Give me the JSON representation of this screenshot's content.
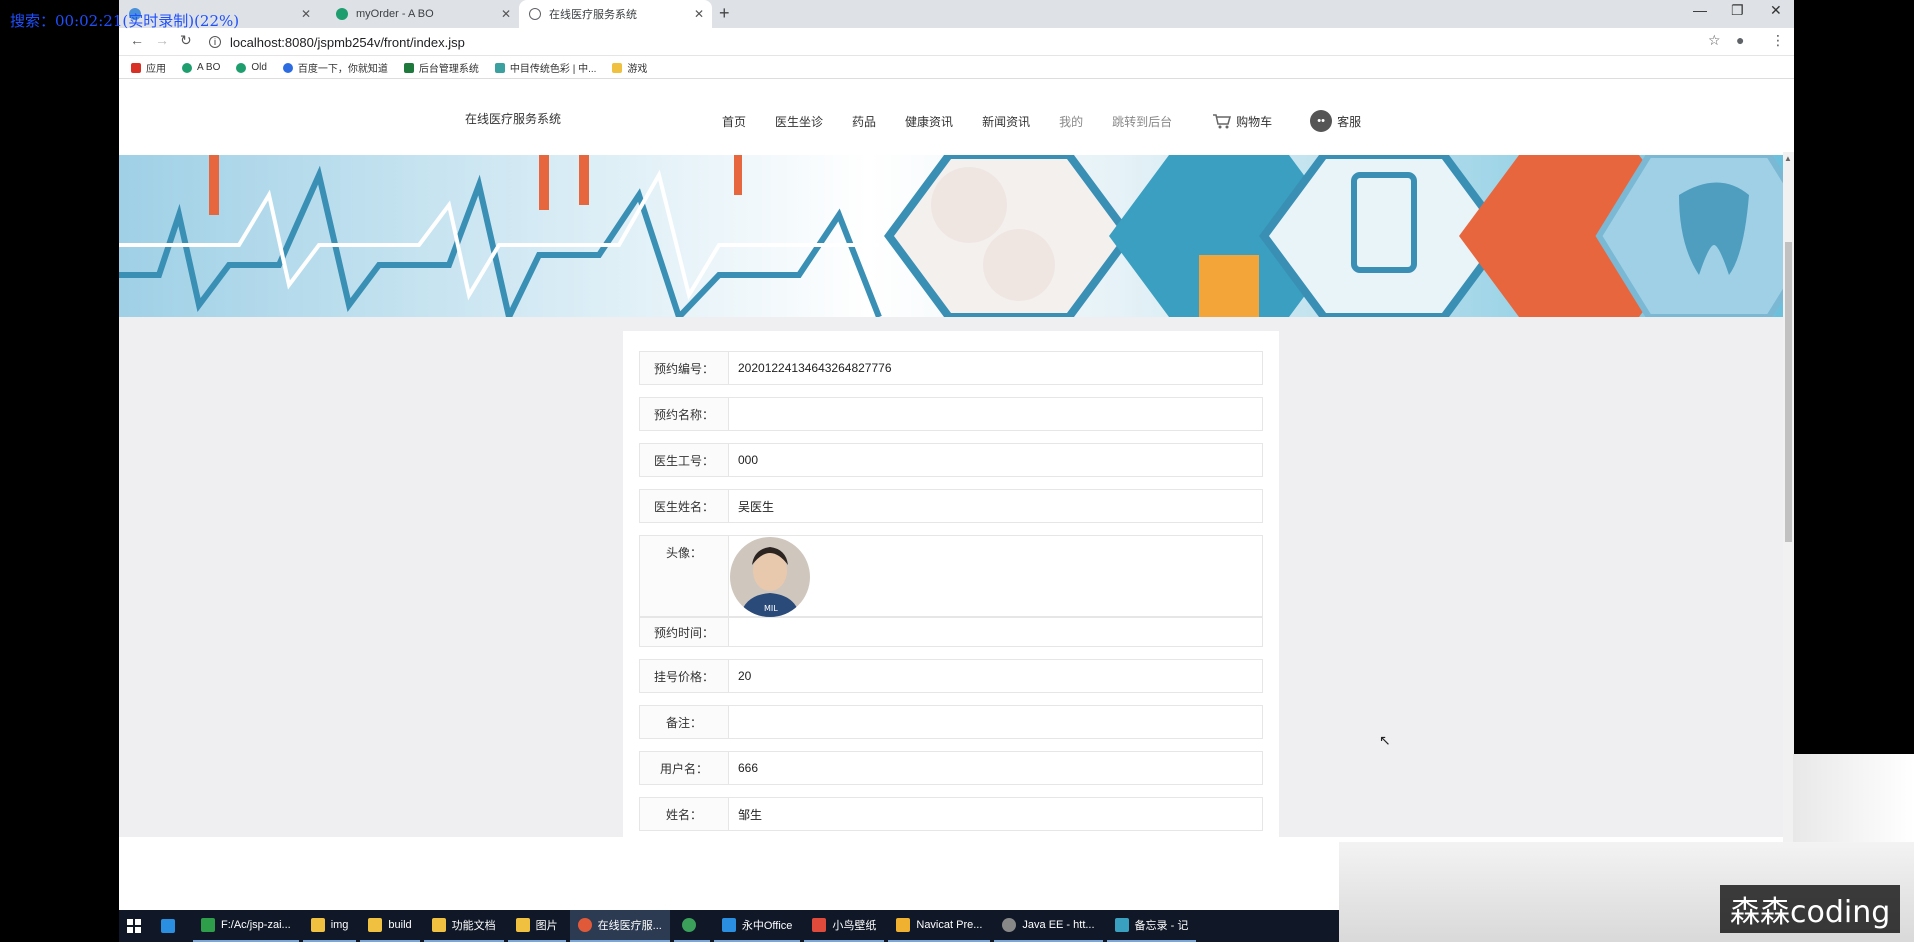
{
  "overlay": {
    "timer": "搜索：00:02:21(实时录制)(22%)"
  },
  "browser": {
    "tabs": [
      {
        "label": "",
        "fav_color": "#4a90d9"
      },
      {
        "label": "myOrder - A BO",
        "fav_color": "#1e9e6e"
      },
      {
        "label": "在线医疗服务系统",
        "fav_color": "#5f6368"
      }
    ],
    "new_tab": "+",
    "close_glyph": "✕",
    "window_controls": {
      "minimize": "—",
      "maximize": "❐",
      "close": "✕"
    },
    "nav": {
      "back": "←",
      "forward": "→",
      "reload": "↻"
    },
    "url": "localhost:8080/jspmb254v/front/index.jsp",
    "star": "☆",
    "profile": "●",
    "menu": "⋮",
    "bookmarks": [
      {
        "label": "应用",
        "color": "#d93025"
      },
      {
        "label": "A BO",
        "color": "#1e9e6e"
      },
      {
        "label": "Old",
        "color": "#1e9e6e"
      },
      {
        "label": "百度一下，你就知道",
        "color": "#2d6ce0"
      },
      {
        "label": "后台管理系统",
        "color": "#1e7a3c"
      },
      {
        "label": "中目传统色彩 | 中...",
        "color": "#3aa0a0"
      },
      {
        "label": "游戏",
        "color": "#f0c040"
      }
    ]
  },
  "site": {
    "brand": "在线医疗服务系统",
    "nav": [
      "首页",
      "医生坐诊",
      "药品",
      "健康资讯",
      "新闻资讯",
      "我的",
      "跳转到后台"
    ],
    "cart": "购物车",
    "service": "客服"
  },
  "detail": {
    "rows": [
      {
        "label": "预约编号：",
        "value": "20201224134643264827776"
      },
      {
        "label": "预约名称：",
        "value": ""
      },
      {
        "label": "医生工号：",
        "value": "000"
      },
      {
        "label": "医生姓名：",
        "value": "吴医生"
      }
    ],
    "avatar_label": "头像：",
    "rows2": [
      {
        "label": "预约时间：",
        "value": ""
      },
      {
        "label": "挂号价格：",
        "value": "20"
      },
      {
        "label": "备注：",
        "value": ""
      },
      {
        "label": "用户名：",
        "value": "666"
      },
      {
        "label": "姓名：",
        "value": "邹生"
      }
    ]
  },
  "taskbar": {
    "items": [
      {
        "label": "",
        "color": "#ffffff"
      },
      {
        "label": "",
        "color": "#2a8fe0"
      },
      {
        "label": "F:/Ac/jsp-zai...",
        "color": "#2e9e4a"
      },
      {
        "label": "img",
        "color": "#f0c040"
      },
      {
        "label": "build",
        "color": "#f0c040"
      },
      {
        "label": "功能文档",
        "color": "#f0c040"
      },
      {
        "label": "图片",
        "color": "#f0c040"
      },
      {
        "label": "在线医疗服...",
        "color": "#e05a3a"
      },
      {
        "label": "",
        "color": "#3aa05a"
      },
      {
        "label": "永中Office",
        "color": "#2a8fe0"
      },
      {
        "label": "小鸟壁纸",
        "color": "#e04a3a"
      },
      {
        "label": "Navicat Pre...",
        "color": "#f0b030"
      },
      {
        "label": "Java EE - htt...",
        "color": "#888888"
      },
      {
        "label": "备忘录 - 记",
        "color": "#3aa0c0"
      }
    ]
  },
  "watermark": "森森coding"
}
